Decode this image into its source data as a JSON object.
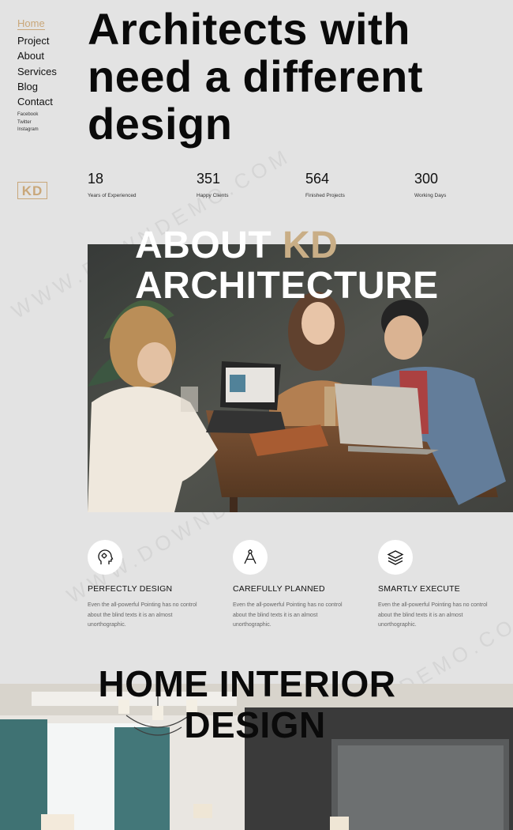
{
  "nav": {
    "items": [
      {
        "label": "Home",
        "active": true
      },
      {
        "label": "Project"
      },
      {
        "label": "About"
      },
      {
        "label": "Services"
      },
      {
        "label": "Blog"
      },
      {
        "label": "Contact"
      }
    ],
    "social": [
      "Facebook",
      "Twitter",
      "Instagram"
    ]
  },
  "logo": "KD",
  "hero": {
    "line1": "Architects with",
    "line2": "need a different",
    "line3": "design"
  },
  "stats": [
    {
      "num": "18",
      "label": "Years of Experienced"
    },
    {
      "num": "351",
      "label": "Happy Clients"
    },
    {
      "num": "564",
      "label": "Finished Projects"
    },
    {
      "num": "300",
      "label": "Working Days"
    }
  ],
  "about": {
    "title_part1": "ABOUT ",
    "title_accent": "KD",
    "title_line2": "ARCHITECTURE",
    "accent_color": "#c9ae86"
  },
  "features": [
    {
      "title": "PERFECTLY DESIGN",
      "desc": "Even the all-powerful Pointing has no control about the blind texts it is an almost unorthographic.",
      "icon": "head-gears-icon"
    },
    {
      "title": "CAREFULLY PLANNED",
      "desc": "Even the all-powerful Pointing has no control about the blind texts it is an almost unorthographic.",
      "icon": "compass-icon"
    },
    {
      "title": "SMARTLY EXECUTE",
      "desc": "Even the all-powerful Pointing has no control about the blind texts it is an almost unorthographic.",
      "icon": "layers-icon"
    }
  ],
  "interior": {
    "line1": "HOME INTERIOR",
    "line2": "DESIGN"
  },
  "watermark": "WWW.DOWNDEMO.COM",
  "colors": {
    "background": "#e3e3e3",
    "accent": "#c9a77a"
  }
}
